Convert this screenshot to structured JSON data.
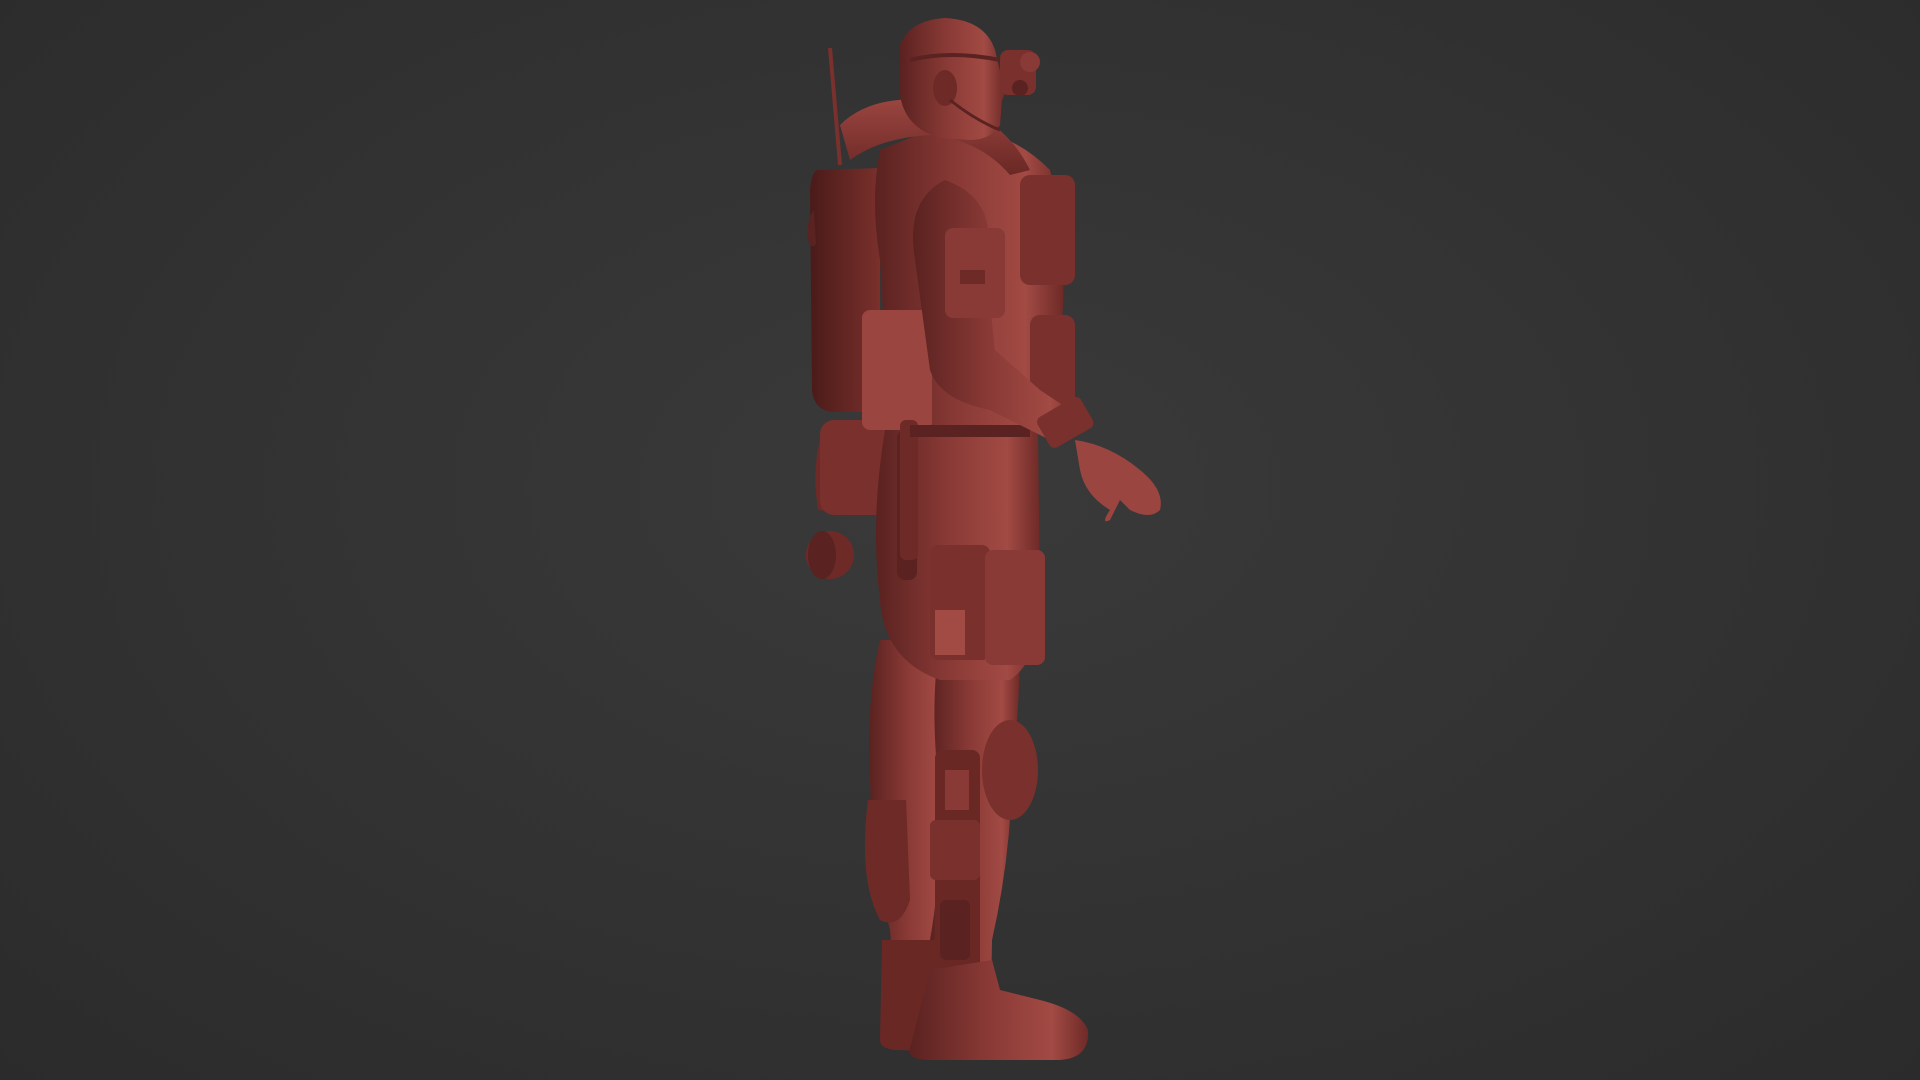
{
  "viewport": {
    "background_color": "#323232"
  },
  "model": {
    "subject": "soldier-sculpt",
    "material_color": "#8a3a36",
    "highlight_color": "#b35750",
    "shadow_color": "#4e1c1a"
  }
}
